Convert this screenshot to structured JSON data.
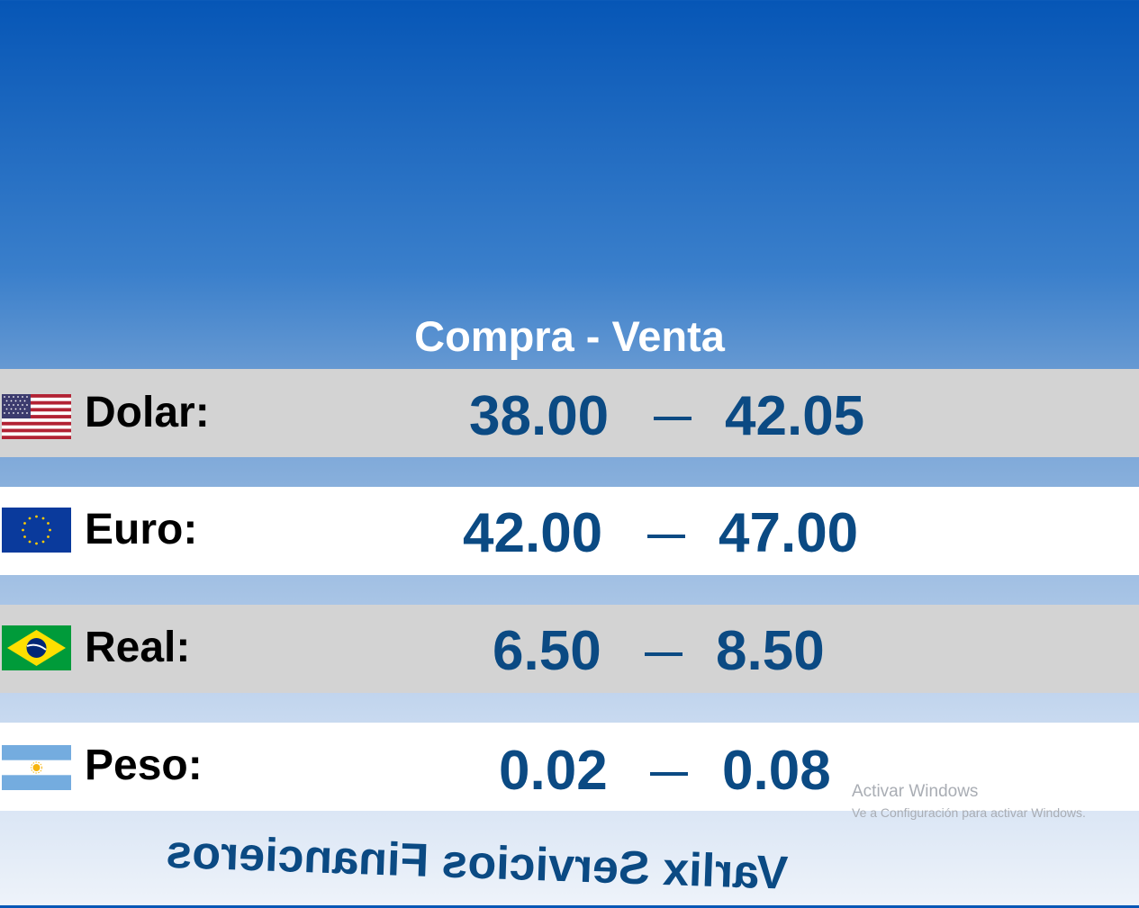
{
  "header": {
    "title": "Compra - Venta"
  },
  "colors": {
    "rate_text": "#0b4a83",
    "label_text": "#000000",
    "row_gray": "#d3d3d3",
    "row_white": "#ffffff",
    "background_top": "#0656b6",
    "background_bottom": "#eef3fa"
  },
  "rates": [
    {
      "flag": "usa-flag-icon",
      "label": "Dolar:",
      "compra": "38.00",
      "venta": "42.05"
    },
    {
      "flag": "eu-flag-icon",
      "label": "Euro:",
      "compra": "42.00",
      "venta": "47.00"
    },
    {
      "flag": "brazil-flag-icon",
      "label": "Real:",
      "compra": "6.50",
      "venta": "8.50"
    },
    {
      "flag": "argentina-flag-icon",
      "label": "Peso:",
      "compra": "0.02",
      "venta": "0.08"
    }
  ],
  "footer": {
    "brand": "Varlix Servicios Financieros"
  },
  "watermark": {
    "title": "Activar Windows",
    "subtitle": "Ve a Configuración para activar Windows."
  }
}
